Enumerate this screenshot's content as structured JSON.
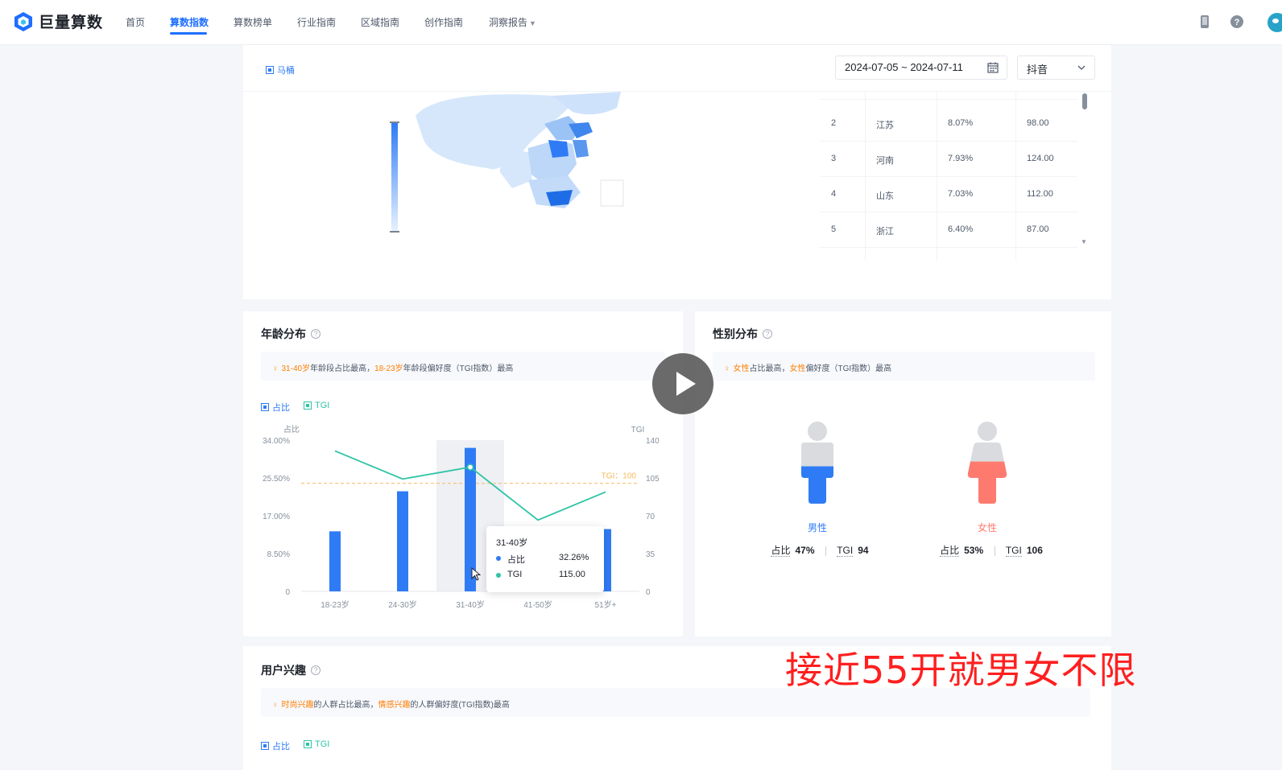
{
  "nav": {
    "logo_text": "巨量算数",
    "items": [
      {
        "label": "首页",
        "active": false
      },
      {
        "label": "算数指数",
        "active": true
      },
      {
        "label": "算数榜单",
        "active": false
      },
      {
        "label": "行业指南",
        "active": false
      },
      {
        "label": "区域指南",
        "active": false
      },
      {
        "label": "创作指南",
        "active": false
      },
      {
        "label": "洞察报告",
        "active": false,
        "dropdown": true
      }
    ],
    "icons": [
      "phone-icon",
      "help-circle-icon",
      "avatar"
    ]
  },
  "region": {
    "keyword_legend": "马桶",
    "date_range": "2024-07-05 ~ 2024-07-11",
    "platform": "抖音",
    "rows": [
      {
        "rank": "2",
        "province": "江苏",
        "share": "8.07%",
        "tgi": "98.00"
      },
      {
        "rank": "3",
        "province": "河南",
        "share": "7.93%",
        "tgi": "124.00"
      },
      {
        "rank": "4",
        "province": "山东",
        "share": "7.03%",
        "tgi": "112.00"
      },
      {
        "rank": "5",
        "province": "浙江",
        "share": "6.40%",
        "tgi": "87.00"
      }
    ]
  },
  "age": {
    "title": "年龄分布",
    "tip": {
      "hl1": "31-40岁",
      "t1": "年龄段占比最高，",
      "hl2": "18-23岁",
      "t2": "年龄段偏好度（TGI指数）最高"
    },
    "legend_share": "占比",
    "legend_tgi": "TGI",
    "left_axis_title": "占比",
    "right_axis_title": "TGI",
    "left_ticks": [
      "0",
      "8.50%",
      "17.00%",
      "25.50%",
      "34.00%"
    ],
    "right_ticks": [
      "0",
      "35",
      "70",
      "105",
      "140"
    ],
    "tgi_ref_label": "TGI：100",
    "tooltip": {
      "title": "31-40岁",
      "share_label": "占比",
      "share_value": "32.26%",
      "tgi_label": "TGI",
      "tgi_value": "115.00"
    }
  },
  "chart_data": {
    "type": "bar",
    "categories": [
      "18-23岁",
      "24-30岁",
      "31-40岁",
      "41-50岁",
      "51岁+"
    ],
    "series": [
      {
        "name": "占比",
        "type": "bar",
        "axis": "left",
        "values": [
          13.5,
          22.5,
          32.26,
          0.5,
          14.0
        ]
      },
      {
        "name": "TGI",
        "type": "line",
        "axis": "right",
        "values": [
          130,
          104,
          115,
          66,
          92
        ]
      }
    ],
    "ylim": [
      0,
      34
    ],
    "y2lim": [
      0,
      140
    ],
    "reference_line": {
      "axis": "right",
      "value": 100,
      "label": "TGI：100"
    },
    "highlighted_category": "31-40岁",
    "colors": {
      "bar": "#2f7bf5",
      "line": "#2ec4a5",
      "ref": "#f7b85c"
    }
  },
  "gender": {
    "title": "性别分布",
    "tip": {
      "hl1": "女性",
      "t1": "占比最高，",
      "hl2": "女性",
      "t2": "偏好度（TGI指数）最高"
    },
    "male": {
      "label": "男性",
      "share_label": "占比",
      "share": "47%",
      "tgi_label": "TGI",
      "tgi": "94",
      "color": "#2f7bf5",
      "fill": 0.47
    },
    "female": {
      "label": "女性",
      "share_label": "占比",
      "share": "53%",
      "tgi_label": "TGI",
      "tgi": "106",
      "color": "#ff7a6e",
      "fill": 0.53
    }
  },
  "interest": {
    "title": "用户兴趣",
    "tip": {
      "hl1": "时尚兴趣",
      "t1": "的人群占比最高，",
      "hl2": "情感兴趣",
      "t2": "的人群偏好度(TGI指数)最高"
    },
    "legend_share": "占比",
    "legend_tgi": "TGI"
  },
  "overlay": {
    "text": "接近55开就男女不限"
  }
}
